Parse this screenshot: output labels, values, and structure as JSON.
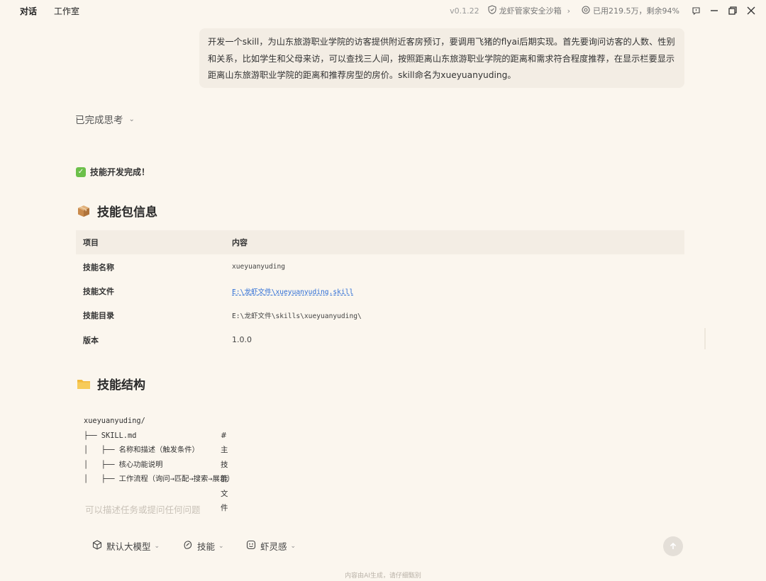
{
  "topbar": {
    "tabs": [
      {
        "label": "对话",
        "active": true
      },
      {
        "label": "工作室",
        "active": false
      }
    ],
    "version": "v0.1.22",
    "sandbox_label": "龙虾管家安全沙箱",
    "quota_label": "已用219.5万，剩余94%"
  },
  "user_message": "开发一个skill，为山东旅游职业学院的访客提供附近客房预订，要调用飞猪的flyai后期实现。首先要询问访客的人数、性别和关系，比如学生和父母来访，可以查找三人间，按照距离山东旅游职业学院的距离和需求符合程度推荐，在显示栏要显示距离山东旅游职业学院的距离和推荐房型的房价。skill命名为xueyuanyuding。",
  "thinking_label": "已完成思考",
  "done_label": "技能开发完成！",
  "package_heading": "技能包信息",
  "table": {
    "headers": [
      "项目",
      "内容"
    ],
    "rows": [
      {
        "key": "技能名称",
        "value": "xueyuanyuding"
      },
      {
        "key": "技能文件",
        "value": "E:\\龙虾文件\\xueyuanyuding.skill"
      },
      {
        "key": "技能目录",
        "value": "E:\\龙虾文件\\skills\\xueyuanyuding\\"
      },
      {
        "key": "版本",
        "value": "1.0.0"
      }
    ]
  },
  "structure_heading": "技能结构",
  "tree": {
    "lines": [
      "xueyuanyuding/",
      "├── SKILL.md",
      "│   ├── 名称和描述（触发条件）",
      "│   ├── 核心功能说明",
      "│   ├── 工作流程（询问→匹配→搜索→展示）"
    ],
    "comment": "# 主技能文件"
  },
  "input": {
    "placeholder": "可以描述任务或提问任何问题"
  },
  "toolbar": {
    "model_label": "默认大模型",
    "skill_label": "技能",
    "inspire_label": "虾灵感"
  },
  "footer_note": "内容由AI生成，请仔细甄别",
  "colors": {
    "background": "#fbf6ee",
    "bubble": "#f3ede4",
    "link": "#2f6fd6",
    "check": "#6cc04a"
  }
}
